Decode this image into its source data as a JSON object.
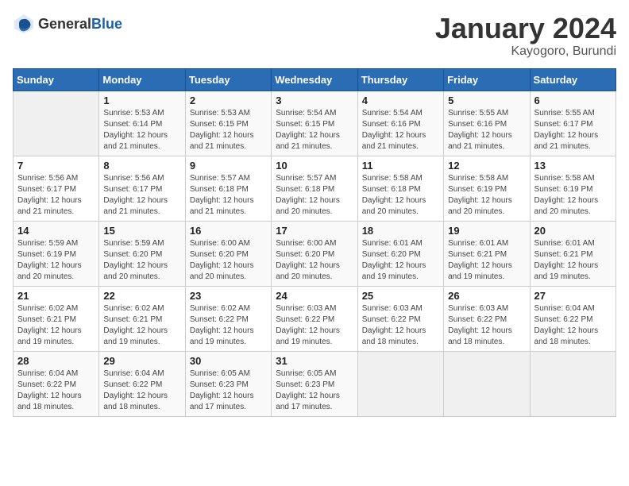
{
  "header": {
    "logo_general": "General",
    "logo_blue": "Blue",
    "month_year": "January 2024",
    "location": "Kayogoro, Burundi"
  },
  "days_of_week": [
    "Sunday",
    "Monday",
    "Tuesday",
    "Wednesday",
    "Thursday",
    "Friday",
    "Saturday"
  ],
  "weeks": [
    [
      {
        "day": "",
        "info": ""
      },
      {
        "day": "1",
        "info": "Sunrise: 5:53 AM\nSunset: 6:14 PM\nDaylight: 12 hours\nand 21 minutes."
      },
      {
        "day": "2",
        "info": "Sunrise: 5:53 AM\nSunset: 6:15 PM\nDaylight: 12 hours\nand 21 minutes."
      },
      {
        "day": "3",
        "info": "Sunrise: 5:54 AM\nSunset: 6:15 PM\nDaylight: 12 hours\nand 21 minutes."
      },
      {
        "day": "4",
        "info": "Sunrise: 5:54 AM\nSunset: 6:16 PM\nDaylight: 12 hours\nand 21 minutes."
      },
      {
        "day": "5",
        "info": "Sunrise: 5:55 AM\nSunset: 6:16 PM\nDaylight: 12 hours\nand 21 minutes."
      },
      {
        "day": "6",
        "info": "Sunrise: 5:55 AM\nSunset: 6:17 PM\nDaylight: 12 hours\nand 21 minutes."
      }
    ],
    [
      {
        "day": "7",
        "info": "Sunrise: 5:56 AM\nSunset: 6:17 PM\nDaylight: 12 hours\nand 21 minutes."
      },
      {
        "day": "8",
        "info": "Sunrise: 5:56 AM\nSunset: 6:17 PM\nDaylight: 12 hours\nand 21 minutes."
      },
      {
        "day": "9",
        "info": "Sunrise: 5:57 AM\nSunset: 6:18 PM\nDaylight: 12 hours\nand 21 minutes."
      },
      {
        "day": "10",
        "info": "Sunrise: 5:57 AM\nSunset: 6:18 PM\nDaylight: 12 hours\nand 20 minutes."
      },
      {
        "day": "11",
        "info": "Sunrise: 5:58 AM\nSunset: 6:18 PM\nDaylight: 12 hours\nand 20 minutes."
      },
      {
        "day": "12",
        "info": "Sunrise: 5:58 AM\nSunset: 6:19 PM\nDaylight: 12 hours\nand 20 minutes."
      },
      {
        "day": "13",
        "info": "Sunrise: 5:58 AM\nSunset: 6:19 PM\nDaylight: 12 hours\nand 20 minutes."
      }
    ],
    [
      {
        "day": "14",
        "info": "Sunrise: 5:59 AM\nSunset: 6:19 PM\nDaylight: 12 hours\nand 20 minutes."
      },
      {
        "day": "15",
        "info": "Sunrise: 5:59 AM\nSunset: 6:20 PM\nDaylight: 12 hours\nand 20 minutes."
      },
      {
        "day": "16",
        "info": "Sunrise: 6:00 AM\nSunset: 6:20 PM\nDaylight: 12 hours\nand 20 minutes."
      },
      {
        "day": "17",
        "info": "Sunrise: 6:00 AM\nSunset: 6:20 PM\nDaylight: 12 hours\nand 20 minutes."
      },
      {
        "day": "18",
        "info": "Sunrise: 6:01 AM\nSunset: 6:20 PM\nDaylight: 12 hours\nand 19 minutes."
      },
      {
        "day": "19",
        "info": "Sunrise: 6:01 AM\nSunset: 6:21 PM\nDaylight: 12 hours\nand 19 minutes."
      },
      {
        "day": "20",
        "info": "Sunrise: 6:01 AM\nSunset: 6:21 PM\nDaylight: 12 hours\nand 19 minutes."
      }
    ],
    [
      {
        "day": "21",
        "info": "Sunrise: 6:02 AM\nSunset: 6:21 PM\nDaylight: 12 hours\nand 19 minutes."
      },
      {
        "day": "22",
        "info": "Sunrise: 6:02 AM\nSunset: 6:21 PM\nDaylight: 12 hours\nand 19 minutes."
      },
      {
        "day": "23",
        "info": "Sunrise: 6:02 AM\nSunset: 6:22 PM\nDaylight: 12 hours\nand 19 minutes."
      },
      {
        "day": "24",
        "info": "Sunrise: 6:03 AM\nSunset: 6:22 PM\nDaylight: 12 hours\nand 19 minutes."
      },
      {
        "day": "25",
        "info": "Sunrise: 6:03 AM\nSunset: 6:22 PM\nDaylight: 12 hours\nand 18 minutes."
      },
      {
        "day": "26",
        "info": "Sunrise: 6:03 AM\nSunset: 6:22 PM\nDaylight: 12 hours\nand 18 minutes."
      },
      {
        "day": "27",
        "info": "Sunrise: 6:04 AM\nSunset: 6:22 PM\nDaylight: 12 hours\nand 18 minutes."
      }
    ],
    [
      {
        "day": "28",
        "info": "Sunrise: 6:04 AM\nSunset: 6:22 PM\nDaylight: 12 hours\nand 18 minutes."
      },
      {
        "day": "29",
        "info": "Sunrise: 6:04 AM\nSunset: 6:22 PM\nDaylight: 12 hours\nand 18 minutes."
      },
      {
        "day": "30",
        "info": "Sunrise: 6:05 AM\nSunset: 6:23 PM\nDaylight: 12 hours\nand 17 minutes."
      },
      {
        "day": "31",
        "info": "Sunrise: 6:05 AM\nSunset: 6:23 PM\nDaylight: 12 hours\nand 17 minutes."
      },
      {
        "day": "",
        "info": ""
      },
      {
        "day": "",
        "info": ""
      },
      {
        "day": "",
        "info": ""
      }
    ]
  ]
}
